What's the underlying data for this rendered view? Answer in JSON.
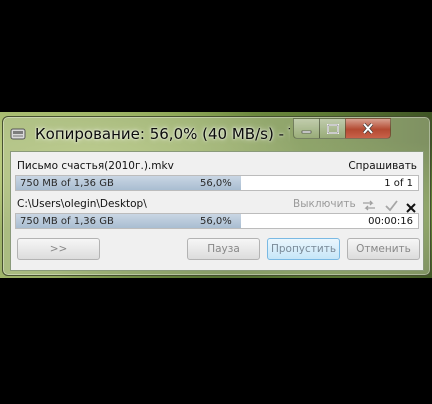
{
  "window": {
    "title": "Копирование: 56,0%  (40 MB/s) - Ter...",
    "controls": {
      "minimize_icon": "minimize-icon",
      "maximize_icon": "maximize-icon",
      "close_icon": "close-icon"
    }
  },
  "source": {
    "filename": "Письмо счастья(2010г.).mkv",
    "ask_label": "Спрашивать",
    "progress": {
      "size_text": "750 MB of 1,36 GB",
      "percent_text": "56,0%",
      "percent": 56.0,
      "count_text": "1 of 1"
    }
  },
  "destination": {
    "path": "C:\\Users\\olegin\\Desktop\\",
    "shutdown_label": "Выключить",
    "progress": {
      "size_text": "750 MB of 1,36 GB",
      "percent_text": "56,0%",
      "percent": 56.0,
      "time_text": "00:00:16"
    }
  },
  "buttons": {
    "more": ">>",
    "pause": "Пауза",
    "skip": "Пропустить",
    "cancel": "Отменить"
  },
  "colors": {
    "progress_fill": "#b4c6d9",
    "skip_button_border": "#7ab9e3",
    "close_button": "#c8533c"
  }
}
